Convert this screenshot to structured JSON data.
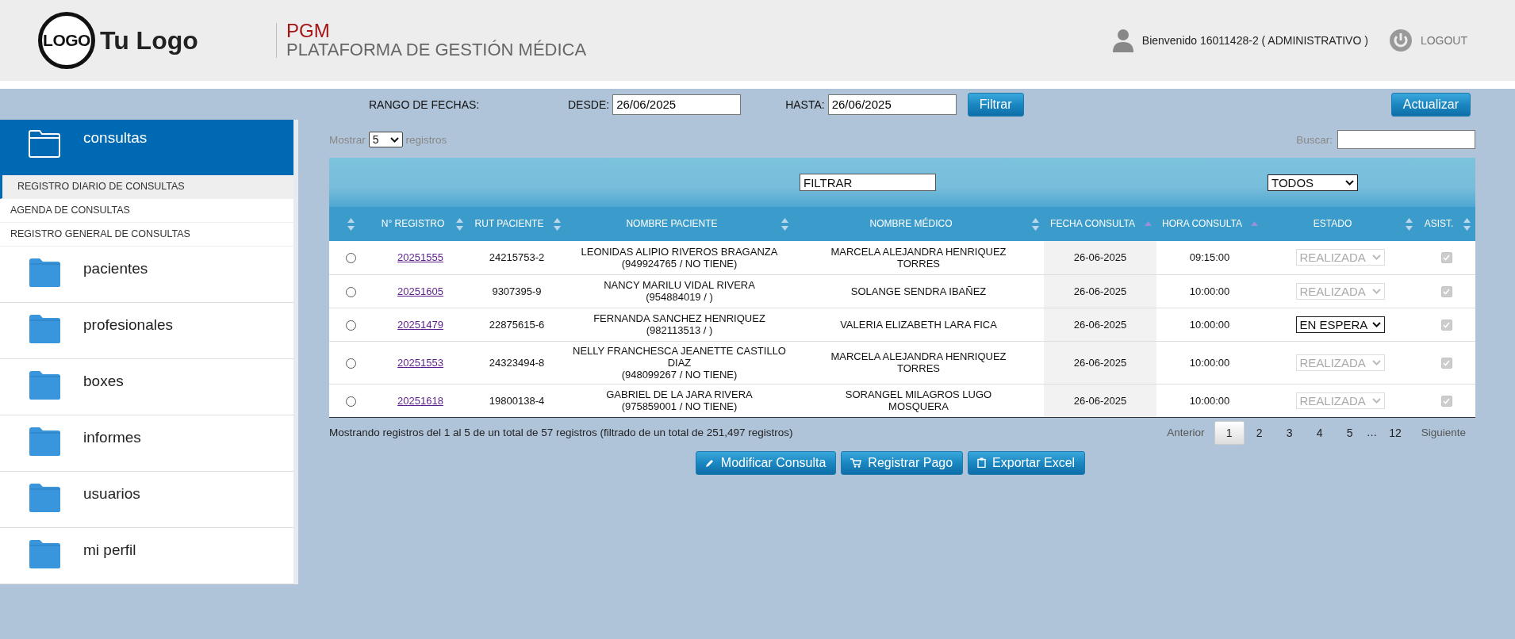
{
  "header": {
    "logo_mark": "LOGO",
    "logo_text": "Tu Logo",
    "app_code": "PGM",
    "app_name": "PLATAFORMA DE GESTIÓN MÉDICA",
    "welcome": "Bienvenido 16011428-2 ( ADMINISTRATIVO )",
    "logout": "LOGOUT"
  },
  "date_filter": {
    "label": "RANGO DE FECHAS:",
    "from_label": "DESDE:",
    "from_value": "26/06/2025",
    "to_label": "HASTA:",
    "to_value": "26/06/2025",
    "filter_button": "Filtrar",
    "refresh_button": "Actualizar"
  },
  "sidebar": {
    "items": [
      {
        "label": "consultas",
        "expanded": true,
        "children": [
          {
            "label": "REGISTRO DIARIO DE CONSULTAS",
            "selected": true
          },
          {
            "label": "AGENDA DE CONSULTAS",
            "selected": false
          },
          {
            "label": "REGISTRO GENERAL DE CONSULTAS",
            "selected": false
          }
        ]
      },
      {
        "label": "pacientes",
        "expanded": false
      },
      {
        "label": "profesionales",
        "expanded": false
      },
      {
        "label": "boxes",
        "expanded": false
      },
      {
        "label": "informes",
        "expanded": false
      },
      {
        "label": "usuarios",
        "expanded": false
      },
      {
        "label": "mi perfil",
        "expanded": false
      }
    ]
  },
  "table_controls": {
    "show_label": "Mostrar",
    "show_value": "5",
    "show_suffix": "registros",
    "search_label": "Buscar:"
  },
  "table": {
    "filters": {
      "medico_filter": "FILTRAR",
      "estado_filter": "TODOS"
    },
    "columns": [
      {
        "kind": "sortable"
      },
      {
        "label": "N° REGISTRO",
        "kind": "sortable"
      },
      {
        "label": "RUT PACIENTE",
        "kind": "sortable"
      },
      {
        "label": "NOMBRE PACIENTE",
        "kind": "sortable"
      },
      {
        "label": "NOMBRE MÉDICO",
        "kind": "sortable"
      },
      {
        "label": "FECHA CONSULTA",
        "kind": "faint"
      },
      {
        "label": "HORA CONSULTA",
        "kind": "faint"
      },
      {
        "label": "ESTADO",
        "kind": "sortable"
      },
      {
        "label": "ASIST.",
        "kind": "sortable"
      }
    ],
    "rows": [
      {
        "selected": false,
        "registro": "20251555",
        "rut": "24215753-2",
        "paciente": "LEONIDAS ALIPIO RIVEROS BRAGANZA",
        "telefono": "(949924765 / NO TIENE)",
        "medico": "MARCELA ALEJANDRA HENRIQUEZ TORRES",
        "fecha": "26-06-2025",
        "hora": "09:15:00",
        "estado": "REALIZADA",
        "estado_disabled": true,
        "asistio": true
      },
      {
        "selected": false,
        "registro": "20251605",
        "rut": "9307395-9",
        "paciente": "NANCY MARILU VIDAL RIVERA",
        "telefono": "(954884019 / )",
        "medico": "SOLANGE SENDRA IBAÑEZ",
        "fecha": "26-06-2025",
        "hora": "10:00:00",
        "estado": "REALIZADA",
        "estado_disabled": true,
        "asistio": true
      },
      {
        "selected": false,
        "registro": "20251479",
        "rut": "22875615-6",
        "paciente": "FERNANDA SANCHEZ HENRIQUEZ",
        "telefono": "(982113513 / )",
        "medico": "VALERIA ELIZABETH LARA FICA",
        "fecha": "26-06-2025",
        "hora": "10:00:00",
        "estado": "EN ESPERA",
        "estado_disabled": false,
        "asistio": true
      },
      {
        "selected": false,
        "registro": "20251553",
        "rut": "24323494-8",
        "paciente": "NELLY FRANCHESCA JEANETTE CASTILLO DIAZ",
        "telefono": "(948099267 / NO TIENE)",
        "medico": "MARCELA ALEJANDRA HENRIQUEZ TORRES",
        "fecha": "26-06-2025",
        "hora": "10:00:00",
        "estado": "REALIZADA",
        "estado_disabled": true,
        "asistio": true
      },
      {
        "selected": false,
        "registro": "20251618",
        "rut": "19800138-4",
        "paciente": "GABRIEL DE LA JARA RIVERA",
        "telefono": "(975859001 / NO TIENE)",
        "medico": "SORANGEL MILAGROS LUGO MOSQUERA",
        "fecha": "26-06-2025",
        "hora": "10:00:00",
        "estado": "REALIZADA",
        "estado_disabled": true,
        "asistio": true
      }
    ]
  },
  "table_info": "Mostrando registros del 1 al 5 de un total de 57 registros (filtrado de un total de 251,497 registros)",
  "pagination": {
    "previous": "Anterior",
    "pages": [
      {
        "label": "1",
        "selected": true
      },
      {
        "label": "2",
        "selected": false
      },
      {
        "label": "3",
        "selected": false
      },
      {
        "label": "4",
        "selected": false
      },
      {
        "label": "5",
        "selected": false
      },
      {
        "label": "…",
        "kind": "ellipsis"
      },
      {
        "label": "12",
        "selected": false
      }
    ],
    "next": "Siguiente"
  },
  "actions": [
    {
      "label": "Modificar Consulta"
    },
    {
      "label": "Registrar Pago"
    },
    {
      "label": "Exportar Excel"
    }
  ]
}
